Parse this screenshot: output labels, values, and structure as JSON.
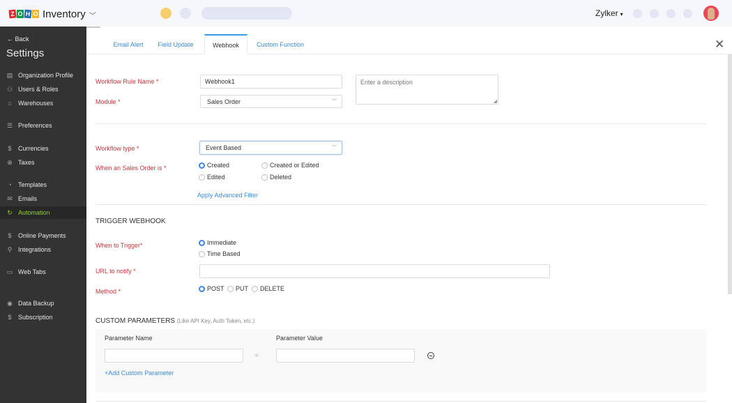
{
  "topbar": {
    "logo_letters": [
      "Z",
      "O",
      "H",
      "O"
    ],
    "app_name": "Inventory",
    "app_chevron": "﹀",
    "org_name": "Zylker",
    "org_caret": "▾",
    "colors": {
      "status_dot_yellow": "#f7cd6f",
      "placeholder": "#e2e5f3",
      "avatar_bg": "#ee4557"
    }
  },
  "sidebar": {
    "back_label": "Back",
    "back_icon": "←",
    "title": "Settings",
    "items": [
      {
        "label": "Organization Profile",
        "icon": "▤",
        "active": false
      },
      {
        "label": "Users & Roles",
        "icon": "⚇",
        "active": false
      },
      {
        "label": "Warehouses",
        "icon": "⌂",
        "active": false
      },
      {
        "label": "Preferences",
        "icon": "☰",
        "active": false
      },
      {
        "label": "Currencies",
        "icon": "$",
        "active": false
      },
      {
        "label": "Taxes",
        "icon": "⊗",
        "active": false
      },
      {
        "label": "Templates",
        "icon": "◔",
        "active": false
      },
      {
        "label": "Emails",
        "icon": "✉",
        "active": false
      },
      {
        "label": "Automation",
        "icon": "↻",
        "active": true
      },
      {
        "label": "Online Payments",
        "icon": "$",
        "active": false
      },
      {
        "label": "Integrations",
        "icon": "⚲",
        "active": false
      },
      {
        "label": "Web Tabs",
        "icon": "▭",
        "active": false
      },
      {
        "label": "Data Backup",
        "icon": "◉",
        "active": false
      },
      {
        "label": "Subscription",
        "icon": "$",
        "active": false
      }
    ],
    "active_color": "#8fd12a"
  },
  "tabs": [
    {
      "label": "Email Alert",
      "active": false
    },
    {
      "label": "Field Update",
      "active": false
    },
    {
      "label": "Webhook",
      "active": true
    },
    {
      "label": "Custom Function",
      "active": false
    }
  ],
  "close_icon": "✕",
  "form": {
    "rule_name_label": "Workflow Rule Name *",
    "rule_name_value": "Webhook1",
    "description_placeholder": "Enter a description",
    "module_label": "Module *",
    "module_value": "Sales Order",
    "workflow_type_label": "Workflow type *",
    "workflow_type_value": "Event Based",
    "when_label": "When an Sales Order is *",
    "when_options": [
      {
        "label": "Created",
        "checked": true
      },
      {
        "label": "Created or Edited",
        "checked": false
      },
      {
        "label": "Edited",
        "checked": false
      },
      {
        "label": "Deleted",
        "checked": false
      }
    ],
    "advanced_filter_link": "Apply Advanced Filter",
    "select_chevron": "﹀"
  },
  "trigger": {
    "section_title": "TRIGGER WEBHOOK",
    "when_label": "When to Trigger*",
    "when_options": [
      {
        "label": "Immediate",
        "checked": true
      },
      {
        "label": "Time Based",
        "checked": false
      }
    ],
    "url_label": "URL to notify *",
    "url_value": "",
    "method_label": "Method *",
    "methods": [
      {
        "label": "POST",
        "checked": true
      },
      {
        "label": "PUT",
        "checked": false
      },
      {
        "label": "DELETE",
        "checked": false
      }
    ]
  },
  "custom_params": {
    "title": "CUSTOM PARAMETERS",
    "hint": "(Like API Key, Auth Token, etc.)",
    "name_header": "Parameter Name",
    "value_header": "Parameter Value",
    "rows": [
      {
        "name": "",
        "value": ""
      }
    ],
    "equals": "=",
    "add_link": "+Add Custom Parameter"
  },
  "colors": {
    "label_required": "#c8373c",
    "link": "#3b8ad6",
    "radio_checked": "#3a86e1",
    "tab_active_border": "#3b9be5"
  }
}
